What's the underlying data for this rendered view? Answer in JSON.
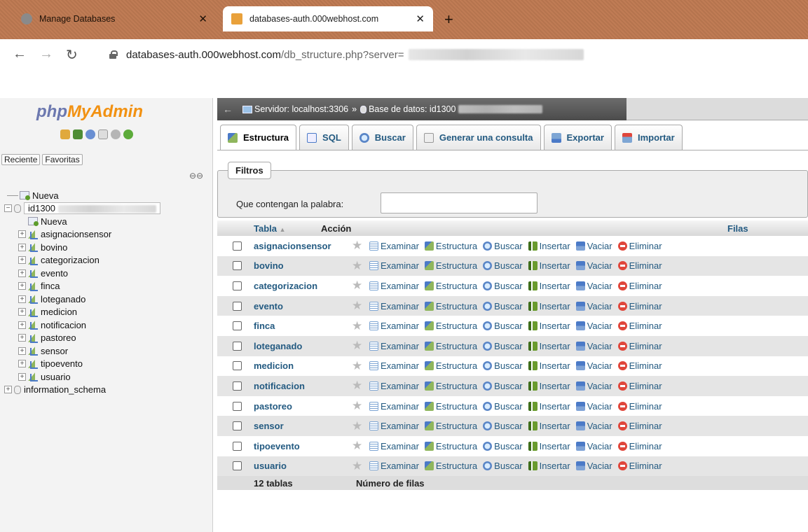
{
  "browser": {
    "tabs": [
      {
        "title": "Manage Databases",
        "favicon_color": "#8a8a8a",
        "active": false
      },
      {
        "title": "databases-auth.000webhost.com",
        "favicon_color": "#e9a13b",
        "active": true
      }
    ],
    "new_tab": "+",
    "close": "✕",
    "url_host": "databases-auth.000webhost.com",
    "url_path": "/db_structure.php?server="
  },
  "nav": {
    "logo_php": "php",
    "logo_myadmin": "MyAdmin",
    "recent": "Reciente",
    "favorites": "Favoritas",
    "tree": {
      "new_root": "Nueva",
      "db_name": "id1300",
      "new_table": "Nueva",
      "tables": [
        "asignacionsensor",
        "bovino",
        "categorizacion",
        "evento",
        "finca",
        "loteganado",
        "medicion",
        "notificacion",
        "pastoreo",
        "sensor",
        "tipoevento",
        "usuario"
      ],
      "other_db": "information_schema"
    }
  },
  "breadcrumb": {
    "server": "Servidor: localhost:3306",
    "sep": "»",
    "database": "Base de datos: id1300"
  },
  "tabs": [
    "Estructura",
    "SQL",
    "Buscar",
    "Generar una consulta",
    "Exportar",
    "Importar"
  ],
  "filters": {
    "legend": "Filtros",
    "label": "Que contengan la palabra:",
    "value": ""
  },
  "table": {
    "headers": {
      "table": "Tabla",
      "sort": "▲",
      "action": "Acción",
      "rows": "Filas"
    },
    "actions": [
      "Examinar",
      "Estructura",
      "Buscar",
      "Insertar",
      "Vaciar",
      "Eliminar"
    ],
    "rows": [
      "asignacionsensor",
      "bovino",
      "categorizacion",
      "evento",
      "finca",
      "loteganado",
      "medicion",
      "notificacion",
      "pastoreo",
      "sensor",
      "tipoevento",
      "usuario"
    ],
    "footer_count": "12 tablas",
    "footer_label": "Número de filas"
  }
}
